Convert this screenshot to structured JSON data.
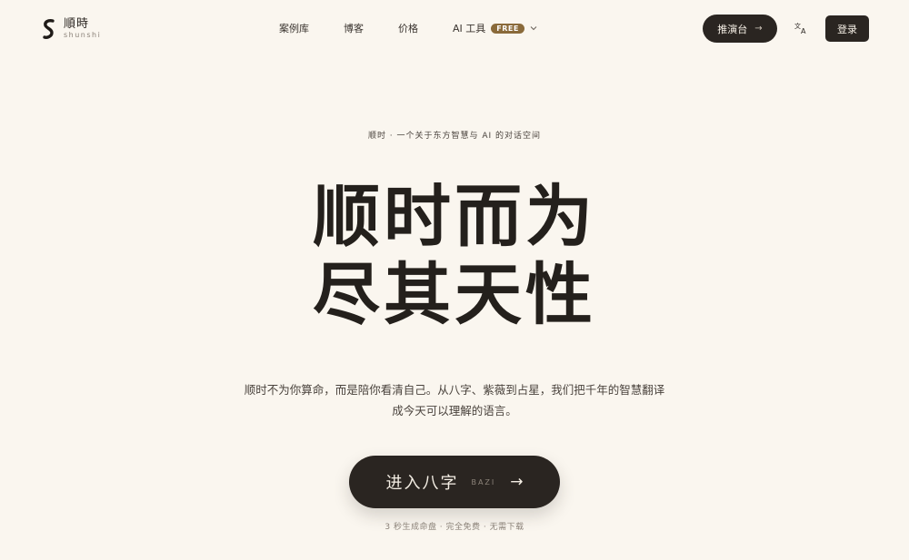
{
  "brand": {
    "name_cn": "順時",
    "name_en": "shunshi"
  },
  "nav": {
    "items": [
      {
        "label": "案例库"
      },
      {
        "label": "博客"
      },
      {
        "label": "价格"
      }
    ],
    "ai_tools": {
      "label": "AI 工具",
      "badge": "FREE"
    }
  },
  "header_actions": {
    "dashboard_label": "推演台",
    "dashboard_arrow": "→",
    "login_label": "登录"
  },
  "hero": {
    "eyebrow": "顺时 · 一个关于东方智慧与 AI 的对话空间",
    "headline_line1": "顺时而为",
    "headline_line2": "尽其天性",
    "description_line1": "顺时不为你算命，而是陪你看清自己。从八字、紫薇到占星，我们把千年的智慧翻译",
    "description_line2": "成今天可以理解的语言。",
    "cta_label": "进入八字",
    "cta_sub": "BAZI",
    "cta_arrow": "→",
    "footnote": "3 秒生成命盘 · 完全免费 · 无需下载"
  },
  "colors": {
    "background": "#faf6ef",
    "primary_dark": "#2a2521",
    "badge_gold": "#8a6a3a"
  },
  "icons": {
    "logo": "s-logo-icon",
    "chevron": "chevron-down-icon",
    "translate": "translate-icon"
  }
}
